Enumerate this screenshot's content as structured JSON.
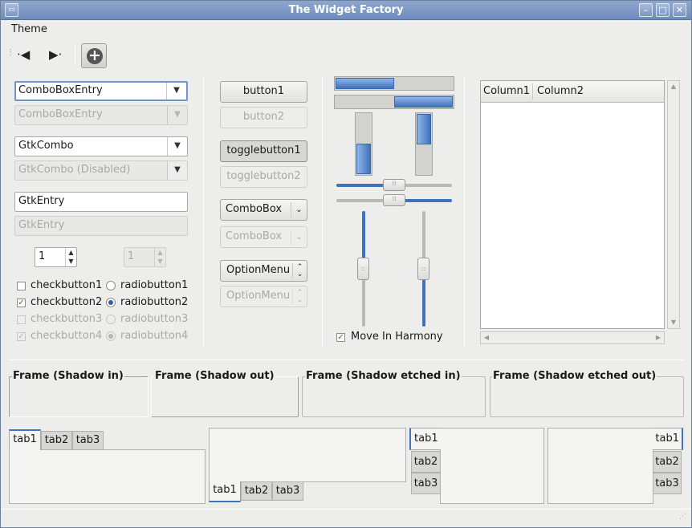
{
  "window": {
    "title": "The Widget Factory"
  },
  "menubar": {
    "theme_label": "Theme"
  },
  "toolbar": {
    "back_glyph": "·◀",
    "forward_glyph": "▶·",
    "add_glyph": "+"
  },
  "col1": {
    "combo_entry_value": "ComboBoxEntry",
    "combo_entry_disabled_value": "ComboBoxEntry",
    "gtkcombo_value": "GtkCombo",
    "gtkcombo_disabled_value": "GtkCombo (Disabled)",
    "entry_value": "GtkEntry",
    "entry_disabled_value": "GtkEntry",
    "spin_value": "1",
    "spin_disabled_value": "1",
    "checkbuttons": [
      {
        "label": "checkbutton1",
        "checked": false
      },
      {
        "label": "checkbutton2",
        "checked": true
      },
      {
        "label": "checkbutton3",
        "checked": false
      },
      {
        "label": "checkbutton4",
        "checked": true
      }
    ],
    "radiobuttons": [
      {
        "label": "radiobutton1",
        "selected": false
      },
      {
        "label": "radiobutton2",
        "selected": true
      },
      {
        "label": "radiobutton3",
        "selected": false
      },
      {
        "label": "radiobutton4",
        "selected": true
      }
    ]
  },
  "col2": {
    "button1": "button1",
    "button2": "button2",
    "togglebutton1": "togglebutton1",
    "togglebutton2": "togglebutton2",
    "combobox": "ComboBox",
    "combobox_disabled": "ComboBox",
    "optionmenu": "OptionMenu",
    "optionmenu_disabled": "OptionMenu"
  },
  "col3": {
    "progress_h1": 0.5,
    "progress_h2": 0.5,
    "progress_v1": 0.5,
    "progress_v2": 0.5,
    "scale_h1": 0.5,
    "scale_h2": 0.5,
    "scale_v1": 0.5,
    "scale_v2": 0.5,
    "harmony_label": "Move In Harmony",
    "harmony_checked": true
  },
  "tree": {
    "columns": [
      "Column1",
      "Column2"
    ],
    "rows": []
  },
  "frames": [
    {
      "label": "Frame (Shadow in)"
    },
    {
      "label": "Frame (Shadow out)"
    },
    {
      "label": "Frame (Shadow etched in)"
    },
    {
      "label": "Frame (Shadow etched out)"
    }
  ],
  "notebooks": [
    {
      "position": "top",
      "tabs": [
        "tab1",
        "tab2",
        "tab3"
      ],
      "active": 0
    },
    {
      "position": "bottom",
      "tabs": [
        "tab1",
        "tab2",
        "tab3"
      ],
      "active": 0
    },
    {
      "position": "left",
      "tabs": [
        "tab1",
        "tab2",
        "tab3"
      ],
      "active": 0
    },
    {
      "position": "right",
      "tabs": [
        "tab1",
        "tab2",
        "tab3"
      ],
      "active": 0
    }
  ],
  "icons": {
    "window_menu": "window-menu-icon",
    "minimize": "minimize-icon",
    "maximize": "maximize-icon",
    "close": "close-icon",
    "checkmark": "✓"
  },
  "colors": {
    "accent": "#3f73c0",
    "titlebar": "#7b96c4"
  }
}
